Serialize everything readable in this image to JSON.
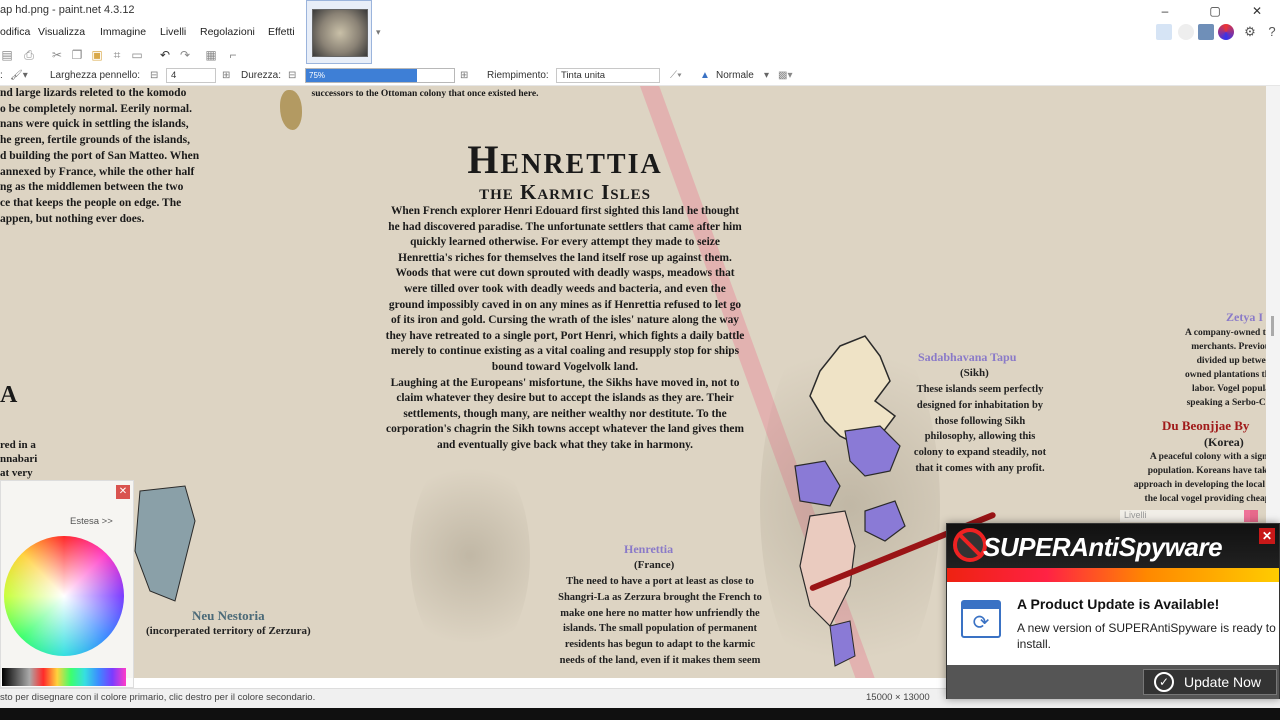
{
  "window": {
    "title": "ap hd.png - paint.net 4.3.12"
  },
  "menu": [
    "odifica",
    "Visualizza",
    "Immagine",
    "Livelli",
    "Regolazioni",
    "Effetti"
  ],
  "toolbar": {
    "brush_width_label": "Larghezza pennello:",
    "brush_width_value": "4",
    "hardness_label": "Durezza:",
    "hardness_value": "75%",
    "fill_label": "Riempimento:",
    "fill_value": "Tinta unita",
    "blend_mode": "Normale"
  },
  "map": {
    "left_text": [
      "nd large lizards releted to the komodo",
      "o be completely normal. Eerily normal.",
      "nans were quick in settling the islands,",
      "he green, fertile grounds of the islands,",
      "d building the port of San Matteo. When",
      "annexed by France, while the other half",
      "ng as the middlemen between the two",
      "",
      "ce that keeps the people on edge. The",
      "appen, but nothing ever does."
    ],
    "top_snippet": "successors to the Ottoman colony that once existed here.",
    "title": "Henrettia",
    "subtitle": "the Karmic Isles",
    "main_text": [
      "When French explorer Henri Edouard first sighted this land he thought",
      "he had discovered paradise. The unfortunate settlers that came after him",
      "quickly learned otherwise. For every attempt they made to seize",
      "Henrettia's riches for themselves the land itself rose up against them.",
      "Woods that were cut down sprouted with deadly wasps, meadows that",
      "were tilled over took with deadly weeds and bacteria, and even the",
      "ground impossibly caved in on any mines as if Henrettia refused to let go",
      "of its iron and gold. Cursing the wrath of the isles' nature along the way",
      "they have retreated to a single port, Port Henri, which fights a daily battle",
      "merely to continue existing as a vital coaling and resupply stop for ships",
      "bound toward Vogelvolk land.",
      "Laughing at the Europeans' misfortune, the Sikhs have moved in, not to",
      "claim whatever they desire but to accept the islands as they are. Their",
      "settlements, though many, are neither wealthy nor destitute. To the",
      "corporation's chagrin the Sikh towns accept whatever the land gives them",
      "and eventually give back what they take in harmony."
    ],
    "left_frag": [
      "A",
      "red in a",
      "nnabari",
      "at very"
    ],
    "sikh": {
      "name": "Sadabhavana Tapu",
      "affiliation": "(Sikh)",
      "text": [
        "These islands seem perfectly",
        "designed for inhabitation by",
        "those following Sikh",
        "philosophy, allowing this",
        "colony to expand steadily, not",
        "that it comes with any profit."
      ]
    },
    "zetya": {
      "name": "Zetya I",
      "text": [
        "A company-owned te",
        "merchants. Previou",
        "divided up betwee",
        "owned plantations th",
        "labor. Vogel popula",
        "speaking a Serbo-Cr"
      ]
    },
    "korea": {
      "name": "Du Beonjjae By",
      "affiliation": "(Korea)",
      "text": [
        "A peaceful colony with a signi",
        "population. Koreans have taki",
        "approach in developing the local i",
        "the local vogel providing cheap"
      ]
    },
    "henrettia_region": {
      "name": "Henrettia",
      "affiliation": "(France)",
      "text": [
        "The need to have a port at least as close to",
        "Shangri-La as Zerzura brought the French to",
        "make one here no matter how unfriendly the",
        "islands. The small population of permanent",
        "residents has begun to adapt to the karmic",
        "needs of the land, even if it makes them seem"
      ]
    },
    "neu_nestoria": {
      "name": "Neu Nestoria",
      "sub": "(incorperated territory of Zerzura)"
    }
  },
  "palette": {
    "more_label": "Estesa >>"
  },
  "layers_panel_label": "Livelli",
  "status": {
    "hint": "sto per disegnare con il colore primario, clic destro per il colore secondario.",
    "size": "15000 × 13000"
  },
  "popup": {
    "brand": "SUPERAntiSpyware",
    "headline": "A Product Update is Available!",
    "message": "A new version of SUPERAntiSpyware is ready to install.",
    "button": "Update Now"
  }
}
